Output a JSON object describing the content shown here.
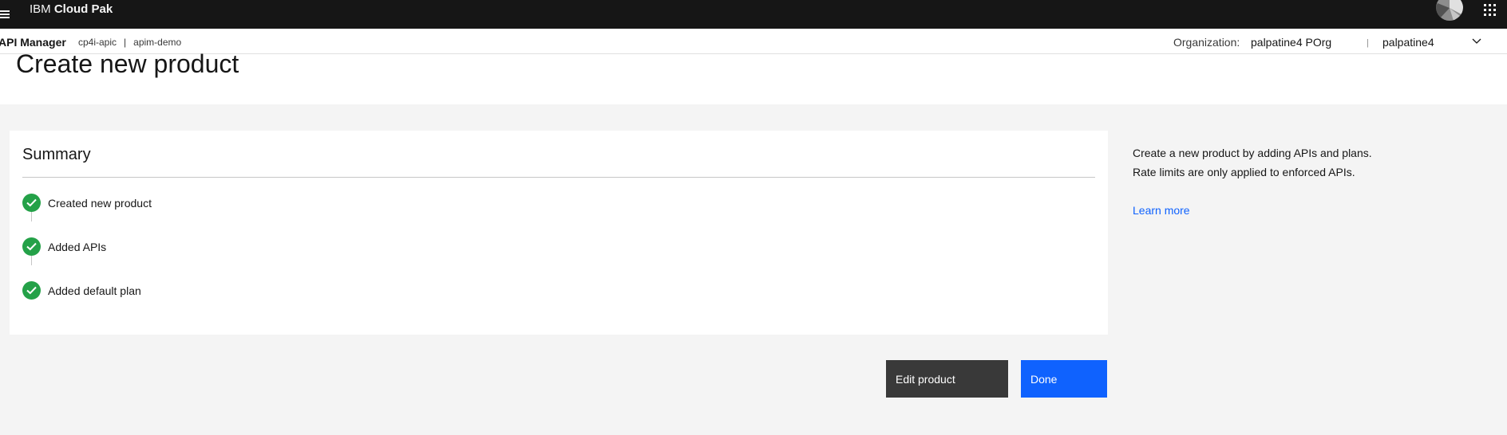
{
  "header": {
    "brand_prefix": "IBM",
    "brand_name": "Cloud Pak",
    "icons": {
      "menu": "hamburger-menu-icon",
      "avatar": "user-avatar",
      "switcher": "app-switcher-grid-icon"
    }
  },
  "subheader": {
    "app_name": "API Manager",
    "crumbs": [
      "cp4i-apic",
      "apim-demo"
    ],
    "crumb_separator": "|",
    "org_label": "Organization:",
    "org_value": "palpatine4 POrg",
    "divider": "|",
    "user_value": "palpatine4"
  },
  "page": {
    "title": "Create new product"
  },
  "summary": {
    "title": "Summary",
    "steps": [
      {
        "label": "Created new product",
        "status": "complete"
      },
      {
        "label": "Added APIs",
        "status": "complete"
      },
      {
        "label": "Added default plan",
        "status": "complete"
      }
    ]
  },
  "actions": {
    "edit_label": "Edit product",
    "done_label": "Done"
  },
  "help": {
    "line1": "Create a new product by adding APIs and plans.",
    "line2": "Rate limits are only applied to enforced APIs.",
    "link": "Learn more"
  },
  "colors": {
    "header_bg": "#161616",
    "success": "#24a148",
    "primary": "#0f62fe",
    "secondary_button": "#393939",
    "page_bg": "#f4f4f4"
  }
}
